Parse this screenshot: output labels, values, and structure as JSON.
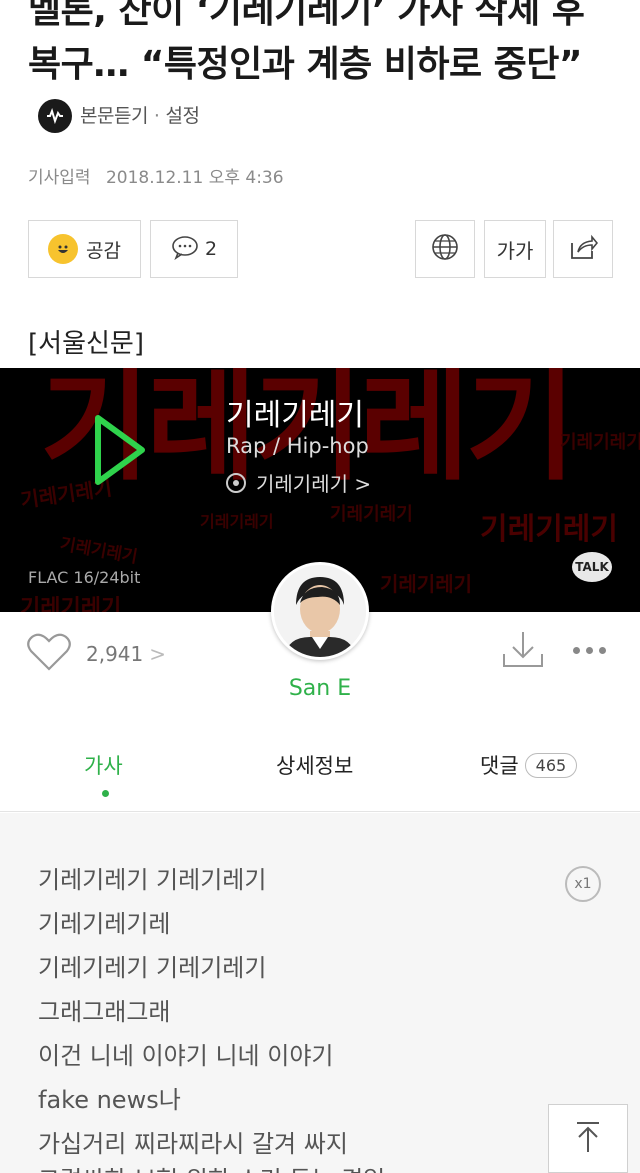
{
  "article": {
    "headline": "멜론, 산이 ‘기레기레기’ 가사 삭제 후 복구… “특정인과 계층 비하로 중단”",
    "listen_label": "본문듣기",
    "separator": "·",
    "settings_label": "설정",
    "date_label": "기사입력",
    "date_value": "2018.12.11 오후 4:36",
    "like_label": "공감",
    "comment_count": "2",
    "font_label": "가가",
    "source": "[서울신문]"
  },
  "player": {
    "bg_title": "기레기레기",
    "bg_word": "기레기레기",
    "song_title": "기레기레기",
    "genre": "Rap / Hip-hop",
    "album": "기레기레기 >",
    "quality": "FLAC 16/24bit",
    "talk_label": "TALK",
    "artist": "San E",
    "like_count": "2,941",
    "like_chevron": ">"
  },
  "tabs": {
    "lyrics": "가사",
    "detail": "상세정보",
    "comments": "댓글",
    "comments_count": "465"
  },
  "lyrics": {
    "repeat_badge": "x1",
    "lines": [
      "기레기레기 기레기레기",
      "기레기레기레",
      "기레기레기 기레기레기",
      "그래그래그래",
      "이건 니네 이야기 니네 이야기",
      "fake news나",
      "가십거리 찌라찌라시 갈겨 싸지",
      "그럴싸한 보험 위한 소리 듣는 격일"
    ]
  },
  "colors": {
    "melon_green": "#2fb14a",
    "bg_red": "#5a0000"
  }
}
